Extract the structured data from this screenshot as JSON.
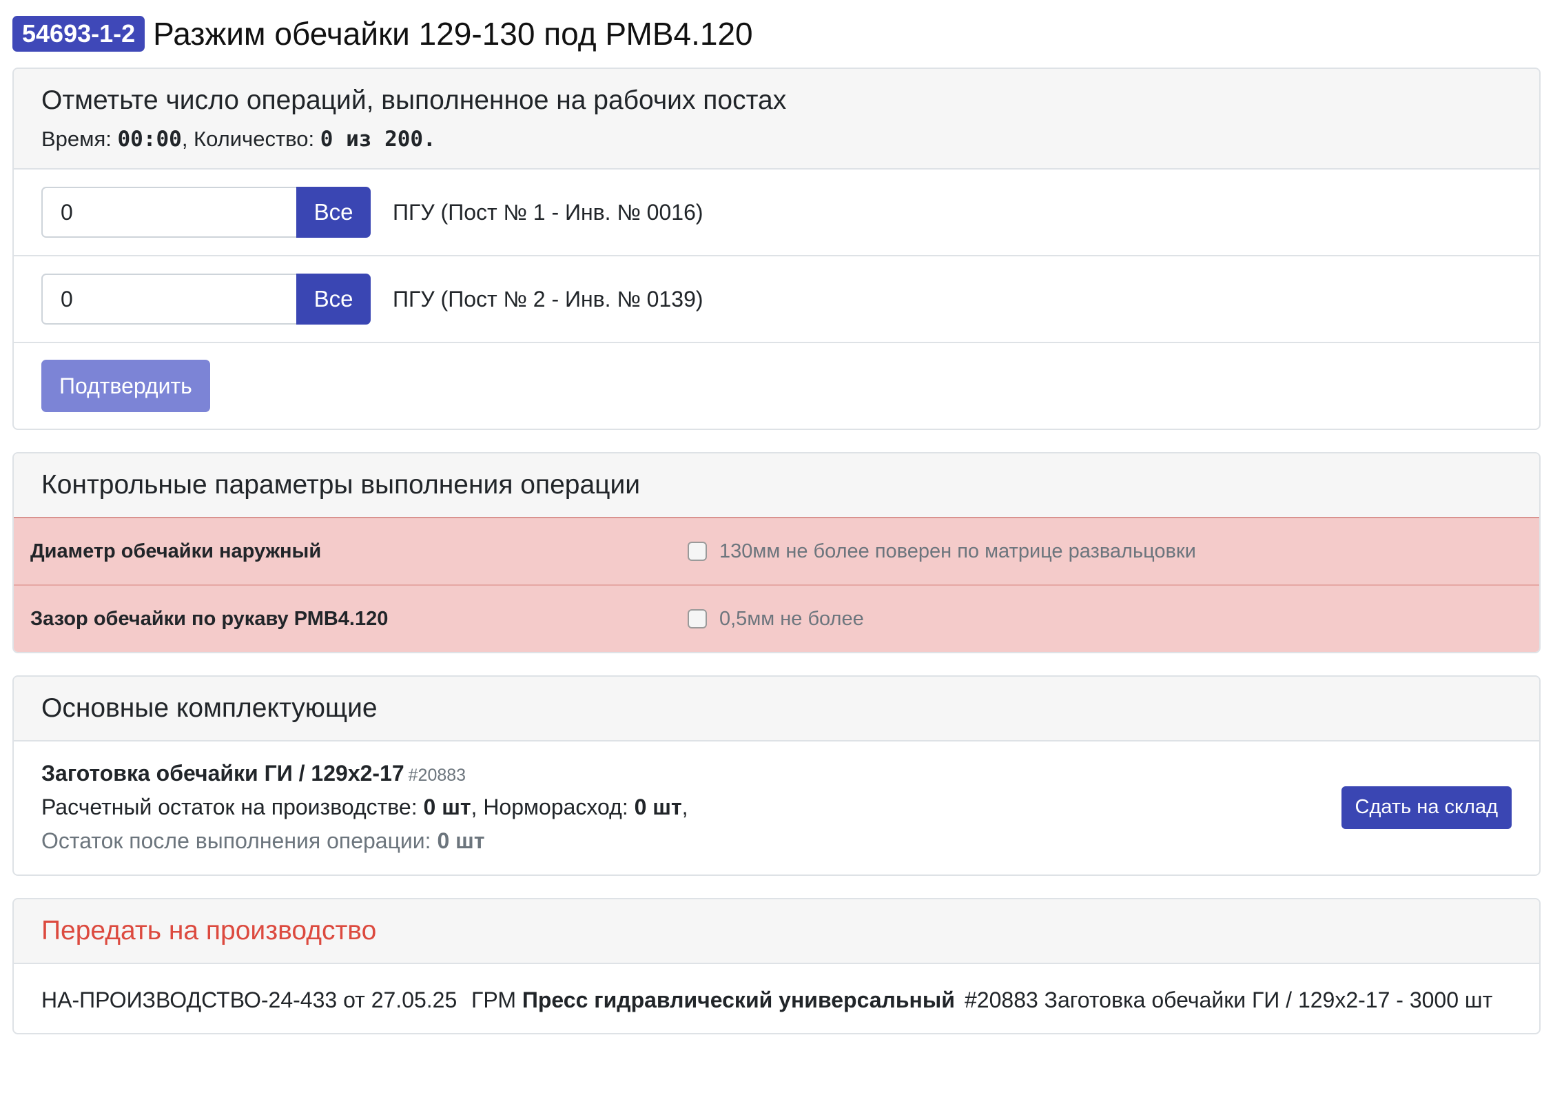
{
  "header": {
    "badge": "54693-1-2",
    "title": "Разжим обечайки 129-130 под РМВ4.120"
  },
  "operations": {
    "title": "Отметьте число операций, выполненное на рабочих постах",
    "time_label": "Время: ",
    "time_value": "00:00",
    "qty_label": ", Количество: ",
    "qty_value": "0 из 200.",
    "posts": [
      {
        "value": "0",
        "button": "Все",
        "label": "ПГУ (Пост № 1 - Инв. № 0016)"
      },
      {
        "value": "0",
        "button": "Все",
        "label": "ПГУ (Пост № 2 - Инв. № 0139)"
      }
    ],
    "confirm_label": "Подтвердить"
  },
  "control": {
    "title": "Контрольные параметры выполнения операции",
    "params": [
      {
        "name": "Диаметр обечайки наружный",
        "value": "130мм не более поверен по матрице развальцовки",
        "checked": false
      },
      {
        "name": "Зазор обечайки по рукаву РМВ4.120",
        "value": "0,5мм не более",
        "checked": false
      }
    ]
  },
  "components": {
    "title": "Основные комплектующие",
    "item": {
      "name": "Заготовка обечайки ГИ / 129х2-17",
      "id": "#20883",
      "remain_label": "Расчетный остаток на производстве: ",
      "remain_value": "0 шт",
      "norm_label": ", Норморасход: ",
      "norm_value": "0 шт",
      "norm_tail": ",",
      "after_label": "Остаток после выполнения операции: ",
      "after_value": "0 шт"
    },
    "stock_button": "Сдать на склад"
  },
  "transfer": {
    "title": "Передать на производство",
    "doc": "НА-ПРОИЗВОДСТВО-24-433 от 27.05.25",
    "equipment_prefix": "ГРМ ",
    "equipment_name": "Пресс гидравлический универсальный",
    "item": "#20883 Заготовка обечайки ГИ / 129х2-17 - 3000 шт"
  },
  "colors": {
    "accent": "#3a46b3",
    "confirm_disabled": "#7c84d6",
    "danger_bg": "#f4cbca",
    "danger_text": "#dc4a3f"
  }
}
